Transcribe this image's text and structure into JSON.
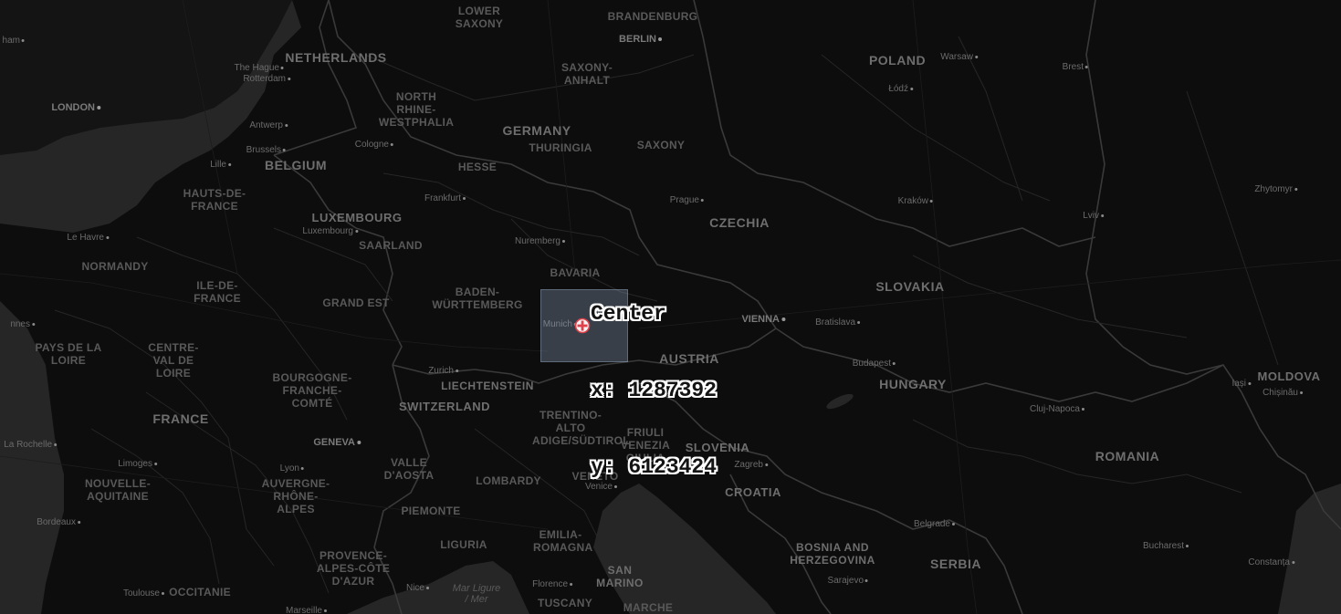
{
  "map": {
    "theme": "dark",
    "accent_color": "#e0414b",
    "extent_box_color": "#96aac8",
    "center_label": {
      "title": "Center",
      "x_line": "x: 1287392",
      "y_line": "y: 6123424"
    },
    "center_marker_icon": "crosshair-plus-icon",
    "labels": {
      "countries": [
        "NETHERLANDS",
        "BELGIUM",
        "LUXEMBOURG",
        "GERMANY",
        "FRANCE",
        "SWITZERLAND",
        "LIECHTENSTEIN",
        "AUSTRIA",
        "CZECHIA",
        "POLAND",
        "SLOVAKIA",
        "HUNGARY",
        "SLOVENIA",
        "CROATIA",
        "BOSNIA AND HERZEGOVINA",
        "SERBIA",
        "ROMANIA",
        "MOLDOVA",
        "SAN MARINO"
      ],
      "regions": [
        "LOWER SAXONY",
        "BRANDENBURG",
        "SAXONY-ANHALT",
        "NORTH RHINE-WESTPHALIA",
        "THURINGIA",
        "SAXONY",
        "HESSE",
        "SAARLAND",
        "BADEN-WÜRTTEMBERG",
        "BAVARIA",
        "HAUTS-DE-FRANCE",
        "NORMANDY",
        "ILE-DE-FRANCE",
        "GRAND EST",
        "PAYS DE LA LOIRE",
        "CENTRE-VAL DE LOIRE",
        "BOURGOGNE-FRANCHE-COMTÉ",
        "NOUVELLE-AQUITAINE",
        "AUVERGNE-RHÔNE-ALPES",
        "PROVENCE-ALPES-CÔTE D'AZUR",
        "OCCITANIE",
        "VALLE D'AOSTA",
        "PIEMONTE",
        "LOMBARDY",
        "LIGURIA",
        "TRENTINO-ALTO ADIGE/SÜDTIROL",
        "VENETO",
        "FRIULI VENEZIA GIULIA",
        "EMILIA-ROMAGNA",
        "TUSCANY",
        "MARCHE"
      ],
      "capitals": [
        "LONDON",
        "BERLIN",
        "VIENNA",
        "GENEVA"
      ],
      "cities": [
        "The Hague",
        "Rotterdam",
        "Antwerp",
        "Brussels",
        "Lille",
        "Cologne",
        "Frankfurt",
        "Luxembourg",
        "Le Havre",
        "Nuremberg",
        "Munich",
        "Prague",
        "Warsaw",
        "Łódź",
        "Brest",
        "Kraków",
        "Lviv",
        "Zhytomyr",
        "Bratislava",
        "Budapest",
        "Zurich",
        "Lyon",
        "Limoges",
        "La Rochelle",
        "Bordeaux",
        "Toulouse",
        "Marseille",
        "Nice",
        "Florence",
        "Venice",
        "Zagreb",
        "Cluj-Napoca",
        "Iași",
        "Chișinău",
        "Belgrade",
        "Bucharest",
        "Constanța",
        "Sarajevo",
        "ham",
        "nnes"
      ],
      "seas": [
        "Mar Ligure / Mer"
      ]
    }
  }
}
